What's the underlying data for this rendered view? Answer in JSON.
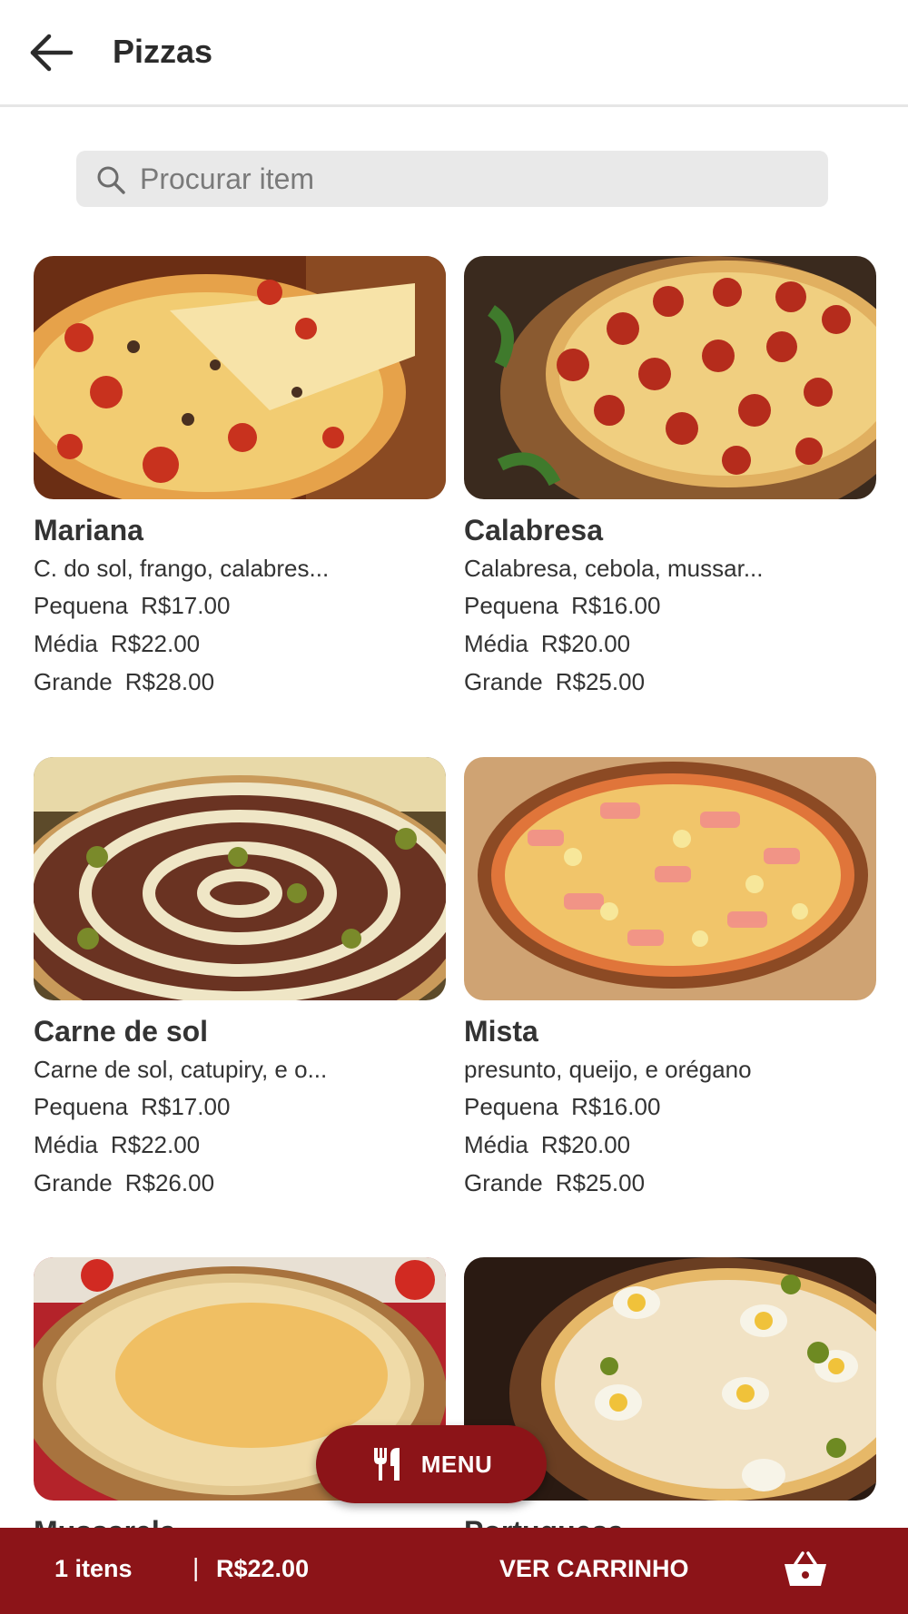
{
  "header": {
    "title": "Pizzas"
  },
  "search": {
    "placeholder": "Procurar item"
  },
  "items": [
    {
      "name": "Mariana",
      "desc": "C. do sol, frango, calabres...",
      "prices": [
        {
          "size": "Pequena",
          "value": "R$17.00"
        },
        {
          "size": "Média",
          "value": "R$22.00"
        },
        {
          "size": "Grande",
          "value": "R$28.00"
        }
      ]
    },
    {
      "name": "Calabresa",
      "desc": "Calabresa, cebola, mussar...",
      "prices": [
        {
          "size": "Pequena",
          "value": "R$16.00"
        },
        {
          "size": "Média",
          "value": "R$20.00"
        },
        {
          "size": "Grande",
          "value": "R$25.00"
        }
      ]
    },
    {
      "name": "Carne de sol",
      "desc": " Carne de sol, catupiry, e o...",
      "prices": [
        {
          "size": "Pequena",
          "value": "R$17.00"
        },
        {
          "size": "Média",
          "value": "R$22.00"
        },
        {
          "size": "Grande",
          "value": "R$26.00"
        }
      ]
    },
    {
      "name": "Mista",
      "desc": "presunto, queijo, e orégano",
      "prices": [
        {
          "size": "Pequena",
          "value": "R$16.00"
        },
        {
          "size": "Média",
          "value": "R$20.00"
        },
        {
          "size": "Grande",
          "value": "R$25.00"
        }
      ]
    },
    {
      "name": "Mussarela"
    },
    {
      "name": "Portuguesa"
    }
  ],
  "menu_button": {
    "label": "MENU",
    "icon": "fork-knife-icon"
  },
  "cart": {
    "count": "1 itens",
    "separator": "|",
    "total": "R$22.00",
    "action": "VER CARRINHO",
    "icon": "basket-icon"
  },
  "colors": {
    "accent": "#8c1418",
    "search_bg": "#e9e9e9"
  }
}
